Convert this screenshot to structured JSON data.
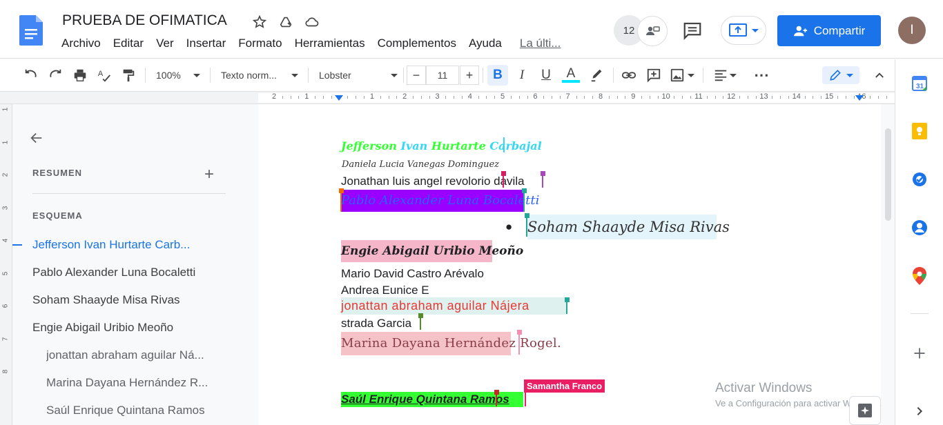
{
  "doc": {
    "title": "PRUEBA DE OFIMATICA",
    "menu": [
      "Archivo",
      "Editar",
      "Ver",
      "Insertar",
      "Formato",
      "Herramientas",
      "Complementos",
      "Ayuda"
    ],
    "last_edit": "La últi...",
    "viewer_count": "12",
    "share_label": "Compartir",
    "user_initial": "I"
  },
  "toolbar": {
    "zoom": "100%",
    "style": "Texto norm...",
    "font": "Lobster",
    "font_size": "11",
    "minus": "−",
    "plus": "+",
    "bold": "B",
    "italic": "I",
    "underline": "U",
    "text_color_letter": "A",
    "more": "⋯"
  },
  "ruler": [
    "2",
    "1",
    "",
    "1",
    "2",
    "3",
    "4",
    "5",
    "6",
    "7",
    "8",
    "9",
    "10",
    "11",
    "12",
    "13",
    "14",
    "15",
    "16"
  ],
  "vruler": [
    "1",
    "1",
    "2",
    "3",
    "4",
    "5",
    "6",
    "7",
    "8"
  ],
  "outline": {
    "summary_label": "RESUMEN",
    "outline_label": "ESQUEMA",
    "items": [
      "Jefferson Ivan Hurtarte Carb...",
      "Pablo Alexander Luna Bocaletti",
      "Soham Shaayde Misa Rivas",
      "Engie Abigail Uribio Meoño",
      "jonattan abraham aguilar Ná...",
      "Marina Dayana Hernández R...",
      "Saúl Enrique Quintana Ramos"
    ]
  },
  "content": {
    "line1a": "Jefferson ",
    "line1b": "Ivan ",
    "line1c": "Hurtarte ",
    "line1d": "Carbajal",
    "line2": "Daniela Lucia Vanegas Dominguez",
    "line3": "Jonathan luis angel revolorio davila",
    "line4": "Pablo Alexander Luna Bocaletti",
    "line5_bullet": "●",
    "line5": "Soham Shaayde Misa Rivas",
    "line6": "Engie Abigail Uribio Meoño",
    "line7": "Mario David Castro Arévalo",
    "line8": " Andrea Eunice E",
    "line9": "jonattan abraham aguilar Nájera",
    "line10": "strada Garcia",
    "line11": "Marina Dayana Hernández Rogel.",
    "line12": "Saúl Enrique Quintana Ramos",
    "cursor_user": "Samantha Franco"
  },
  "watermark": {
    "title": "Activar Windows",
    "subtitle": "Ve a Configuración para activar Windows."
  },
  "colors": {
    "accent": "#1a73e8",
    "green_text": "#33ff33",
    "cyan_text": "#36d7f5",
    "purple_hl": "#9900ff",
    "pink_hl": "#f4b6c8",
    "red_text": "#e53935",
    "green_hl": "#33ff33"
  }
}
